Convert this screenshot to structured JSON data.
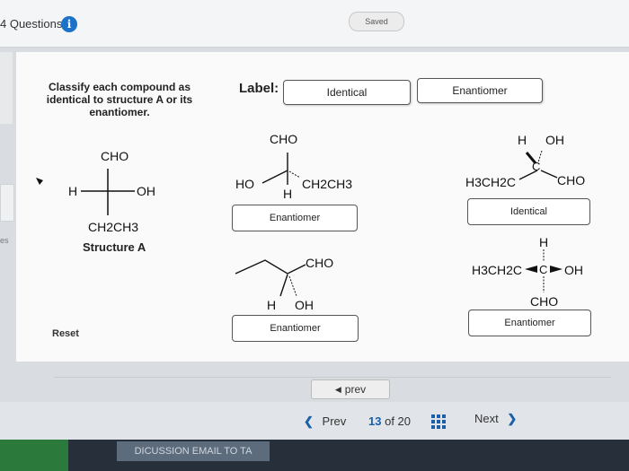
{
  "header": {
    "questions_label": "4 Questions",
    "info_icon": "i",
    "saved_label": "Saved"
  },
  "edge_text": "es",
  "instructions": "Classify each compound as identical to structure A or its enantiomer.",
  "label_title": "Label:",
  "label_chips": [
    "Identical",
    "Enantiomer"
  ],
  "structure_a": {
    "top": "CHO",
    "left": "H",
    "right": "OH",
    "bottom": "CH2CH3",
    "caption": "Structure A"
  },
  "compounds": [
    {
      "top": "CHO",
      "left": "HO",
      "right": "CH2CH3",
      "bottom": "H",
      "answer": "Enantiomer"
    },
    {
      "top_left": "H",
      "top_right": "OH",
      "center": "C",
      "left": "H3CH2C",
      "right": "CHO",
      "answer": "Identical"
    },
    {
      "right": "CHO",
      "bottom_left": "H",
      "bottom_right": "OH",
      "answer": "Enantiomer"
    },
    {
      "top": "H",
      "left": "H3CH2C",
      "center": "C",
      "right": "OH",
      "bottom": "CHO",
      "answer": "Enantiomer"
    }
  ],
  "reset_label": "Reset",
  "prev_small_label": "prev",
  "nav": {
    "prev": "Prev",
    "current": "13",
    "of_text": "of 20",
    "next": "Next"
  },
  "bottom_button": "DICUSSION EMAIL TO TA",
  "colors": {
    "accent": "#1c72c9"
  },
  "icons": [
    "info-icon",
    "chevron-left-icon",
    "chevron-right-icon",
    "grid-icon",
    "caret-left-icon"
  ]
}
